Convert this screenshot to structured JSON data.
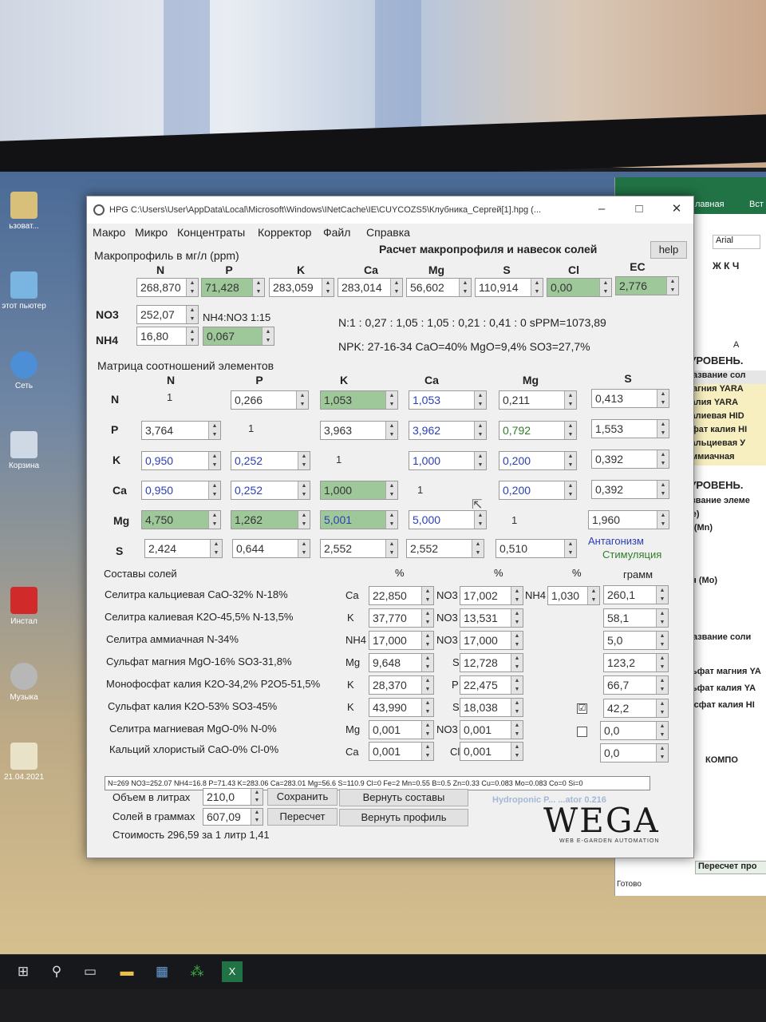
{
  "desktop": {
    "icons": [
      {
        "label": "ьзоват..."
      },
      {
        "label": "этот\nпьютер"
      },
      {
        "label": "Сеть"
      },
      {
        "label": "Корзина"
      },
      {
        "label": "Инстал"
      },
      {
        "label": "Музыка"
      },
      {
        "label": "21.04.2021"
      }
    ]
  },
  "excel": {
    "tabs": [
      "лавная",
      "Вст"
    ],
    "font": "Arial",
    "column": "A",
    "rows_top": [
      "-УРОВЕНЬ.",
      "Название сол",
      "магния YARA",
      "калия YARA",
      "калиевая HID",
      "сфат калия HI",
      "кальциевая У",
      "аммиачная"
    ],
    "rows_mid": [
      "-УРОВЕНЬ.",
      "азвание элеме",
      "Fe)",
      "ц (Mn)",
      ")",
      "з)",
      "ен (Mo)"
    ],
    "rows_low": [
      "Название соли",
      "льфат магния YA",
      "льфат калия YA",
      "фсфат калия HI"
    ],
    "kompo": "КОМПО",
    "recalc": "Пересчет про",
    "ready": "Готово"
  },
  "window": {
    "title": "HPG C:\\Users\\User\\AppData\\Local\\Microsoft\\Windows\\INetCache\\IE\\CUYCOZS5\\Клубника_Сергей[1].hpg (...",
    "menu_tabs": [
      "Макро",
      "Микро",
      "Концентраты",
      "Корректор",
      "Файл",
      "Справка"
    ],
    "heading": "Расчет макропрофиля и навесок солей",
    "help": "help",
    "macro_label": "Макропрофиль в мг/л (ppm)",
    "macro_headers": [
      "N",
      "P",
      "K",
      "Ca",
      "Mg",
      "S",
      "Cl",
      "EC"
    ],
    "macro_values": [
      "268,870",
      "71,428",
      "283,059",
      "283,014",
      "56,602",
      "110,914",
      "0,00",
      "2,776"
    ],
    "no3_label": "NO3",
    "no3_value": "252,07",
    "nh4_label": "NH4",
    "nh4_value": "16,80",
    "nh4_ratio_label": "NH4:NO3 1:15",
    "nh4_ratio_value": "0,067",
    "ratio_line": "N:1 : 0,27 : 1,05 : 1,05 : 0,21 : 0,41 : 0 sPPM=1073,89",
    "npk_line": "NPK: 27-16-34 CaO=40% MgO=9,4% SO3=27,7%",
    "matrix_label": "Матрица соотношений элементов",
    "matrix_headers": [
      "N",
      "P",
      "K",
      "Ca",
      "Mg",
      "S"
    ],
    "matrix_rows": [
      {
        "name": "N",
        "cells": [
          "1",
          "0,266",
          "1,053",
          "1,053",
          "0,211",
          "0,413"
        ]
      },
      {
        "name": "P",
        "cells": [
          "3,764",
          "1",
          "3,963",
          "3,962",
          "0,792",
          "1,553"
        ]
      },
      {
        "name": "K",
        "cells": [
          "0,950",
          "0,252",
          "1",
          "1,000",
          "0,200",
          "0,392"
        ]
      },
      {
        "name": "Ca",
        "cells": [
          "0,950",
          "0,252",
          "1,000",
          "1",
          "0,200",
          "0,392"
        ]
      },
      {
        "name": "Mg",
        "cells": [
          "4,750",
          "1,262",
          "5,001",
          "5,000",
          "1",
          "1,960"
        ]
      },
      {
        "name": "S",
        "cells": [
          "2,424",
          "0,644",
          "2,552",
          "2,552",
          "0,510",
          ""
        ]
      }
    ],
    "antagonism": "Антагонизм",
    "stimulation": "Стимуляция",
    "salts_label": "Составы солей",
    "pct": "%",
    "gram": "грамм",
    "salts": [
      {
        "name": "Селитра кальциевая CaO-32% N-18%",
        "e1": "Ca",
        "v1": "22,850",
        "e2": "NO3",
        "v2": "17,002",
        "e3": "NH4",
        "v3": "1,030",
        "g": "260,1"
      },
      {
        "name": "Селитра калиевая K2O-45,5% N-13,5%",
        "e1": "K",
        "v1": "37,770",
        "e2": "NO3",
        "v2": "13,531",
        "g": "58,1"
      },
      {
        "name": "Селитра аммиачная N-34%",
        "e1": "NH4",
        "v1": "17,000",
        "e2": "NO3",
        "v2": "17,000",
        "g": "5,0"
      },
      {
        "name": "Сульфат магния MgO-16% SO3-31,8%",
        "e1": "Mg",
        "v1": "9,648",
        "e2": "S",
        "v2": "12,728",
        "g": "123,2"
      },
      {
        "name": "Монофосфат калия K2O-34,2% P2O5-51,5%",
        "e1": "K",
        "v1": "28,370",
        "e2": "P",
        "v2": "22,475",
        "g": "66,7"
      },
      {
        "name": "Сульфат калия K2O-53% SO3-45%",
        "e1": "K",
        "v1": "43,990",
        "e2": "S",
        "v2": "18,038",
        "g": "42,2",
        "chk": "☑"
      },
      {
        "name": "Селитра магниевая MgO-0% N-0%",
        "e1": "Mg",
        "v1": "0,001",
        "e2": "NO3",
        "v2": "0,001",
        "g": "0,0",
        "chk": ""
      },
      {
        "name": "Кальций хлористый CaO-0% Cl-0%",
        "e1": "Ca",
        "v1": "0,001",
        "e2": "Cl",
        "v2": "0,001",
        "g": "0,0"
      }
    ],
    "status_line": "N=269 NO3=252.07 NH4=16.8 P=71.43 K=283.06 Ca=283.01 Mg=56.6 S=110.9 Cl=0 Fe=2 Mn=0.55 B=0.5 Zn=0.33 Cu=0.083 Mo=0.083 Co=0 Si=0",
    "volume_label": "Объем в литрах",
    "volume_value": "210,0",
    "salts_g_label": "Солей в граммах",
    "salts_g_value": "607,09",
    "save": "Сохранить",
    "recalc": "Пересчет",
    "restore_compositions": "Вернуть составы",
    "restore_profile": "Вернуть профиль",
    "cost": "Стоимость 296,59 за 1 литр 1,41",
    "brand_small": "Hydroponic P... ...ator 0.216",
    "logo": "WEGA",
    "logo_sub": "WEB E-GARDEN AUTOMATION"
  },
  "taskbar": {
    "icons": [
      "windows-icon",
      "search-icon",
      "task-view-icon",
      "explorer-icon",
      "network-icon",
      "app-icon",
      "excel-icon"
    ]
  }
}
